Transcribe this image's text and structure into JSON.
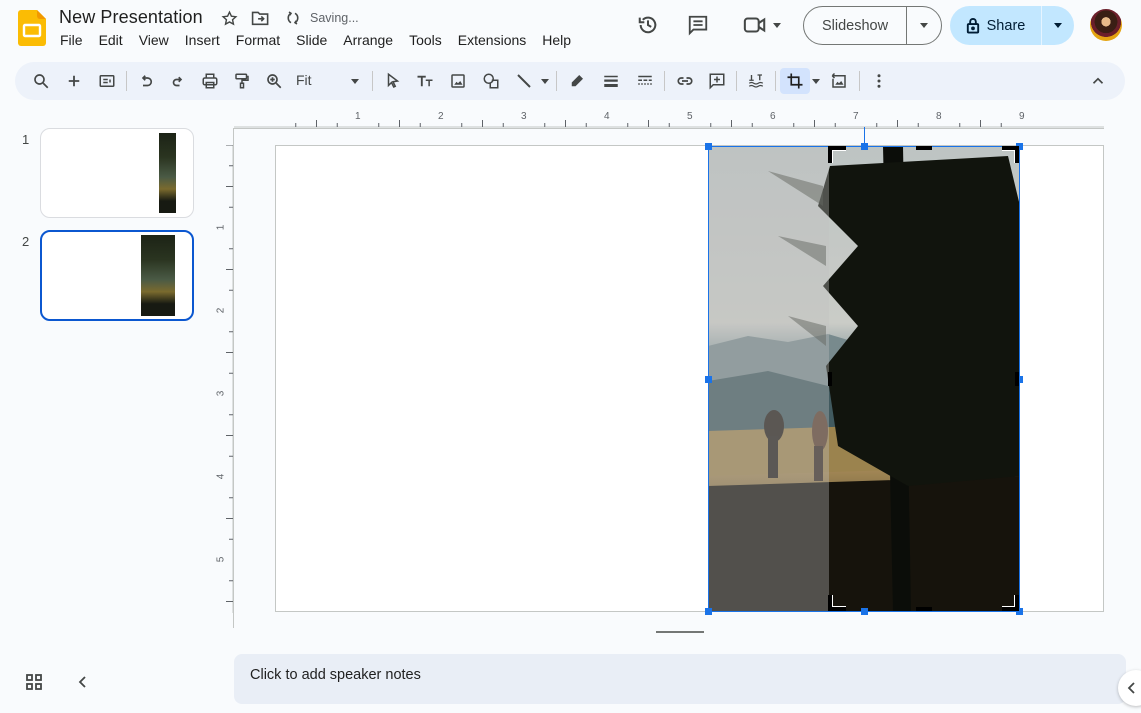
{
  "app": {
    "title": "New Presentation",
    "status": "Saving...",
    "icons": {
      "logo": "slides-logo",
      "star": "star-icon",
      "move": "move-to-folder-icon",
      "sync": "saving-sync-icon"
    }
  },
  "menu": [
    "File",
    "Edit",
    "View",
    "Insert",
    "Format",
    "Slide",
    "Arrange",
    "Tools",
    "Extensions",
    "Help"
  ],
  "header_right": {
    "history_icon": "version-history-icon",
    "comments_icon": "comments-icon",
    "meet_icon": "video-call-icon",
    "slideshow_label": "Slideshow",
    "share_label": "Share",
    "share_icon": "lock-icon",
    "avatar": "user-avatar"
  },
  "toolbar": {
    "zoom_value": "Fit",
    "items": [
      "search-menus",
      "new-slide",
      "layout",
      "undo",
      "redo",
      "print",
      "paint-format",
      "zoom",
      "select",
      "text-box",
      "insert-image",
      "shape",
      "line",
      "border-color",
      "border-weight",
      "border-dash",
      "insert-link",
      "add-comment",
      "alt-text",
      "crop-image",
      "reset-image",
      "more-options",
      "collapse-toolbar"
    ]
  },
  "filmstrip": {
    "slides": [
      {
        "number": "1",
        "selected": false
      },
      {
        "number": "2",
        "selected": true
      }
    ]
  },
  "rulers": {
    "horizontal": [
      "1",
      "2",
      "3",
      "4",
      "5",
      "6",
      "7",
      "8",
      "9"
    ],
    "vertical": [
      "1",
      "2",
      "3",
      "4",
      "5"
    ]
  },
  "canvas": {
    "image_description": "Hikers on mountain meadow beside a pine tree",
    "mode": "crop"
  },
  "notes": {
    "placeholder": "Click to add speaker notes"
  },
  "bottom": {
    "grid_view_icon": "grid-view-icon",
    "collapse_icon": "chevron-left-icon",
    "side_panel_icon": "chevron-left-icon"
  }
}
